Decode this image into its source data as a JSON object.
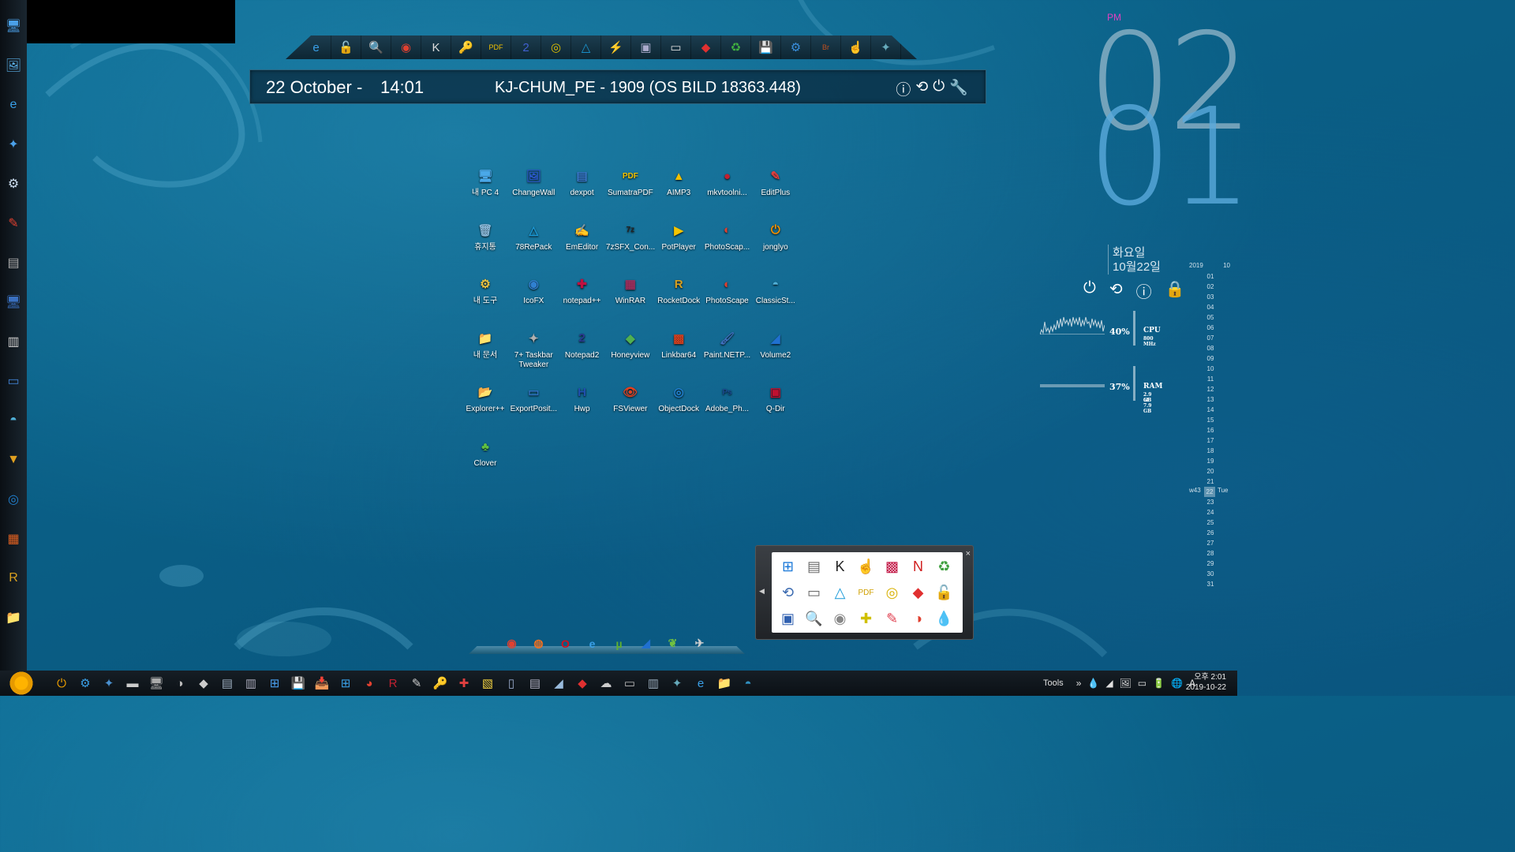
{
  "top_toolbar": {
    "icons": [
      "ie-icon",
      "unlock-icon",
      "search-icon",
      "screenshot-icon",
      "k-app-icon",
      "key-icon",
      "pdf-icon",
      "notepad2-icon",
      "cd-icon",
      "78repack-icon",
      "flash-icon",
      "display-icon",
      "note-icon",
      "git-icon",
      "green-app-icon",
      "floppy-icon",
      "gear-icon",
      "bridge-icon",
      "hand-icon",
      "tweak-icon"
    ]
  },
  "info_bar": {
    "date": "22 October -",
    "time": "14:01",
    "host": "KJ-CHUM_PE - 1909 (OS BILD 18363.448)",
    "controls": [
      "ⓘ",
      "⟲",
      "⏻",
      "🔧"
    ]
  },
  "desktop_icons": [
    {
      "label": "내 PC 4",
      "glyph": "🖥",
      "color": "#4aa8e8"
    },
    {
      "label": "ChangeWall",
      "glyph": "🖼",
      "color": "#2a58c8"
    },
    {
      "label": "dexpot",
      "glyph": "▤",
      "color": "#3a7ad0"
    },
    {
      "label": "SumatraPDF",
      "glyph": "PDF",
      "color": "#f4c400"
    },
    {
      "label": "AIMP3",
      "glyph": "▲",
      "color": "#f0c000"
    },
    {
      "label": "mkvtoolni...",
      "glyph": "●",
      "color": "#c02030"
    },
    {
      "label": "EditPlus",
      "glyph": "✎",
      "color": "#e04040"
    },
    {
      "label": "휴지통",
      "glyph": "🗑",
      "color": "#8ab8d8"
    },
    {
      "label": "78RePack",
      "glyph": "△",
      "color": "#1a9ad8"
    },
    {
      "label": "EmEditor",
      "glyph": "✍",
      "color": "#e8e8e8"
    },
    {
      "label": "7zSFX_Con...",
      "glyph": "7z",
      "color": "#222"
    },
    {
      "label": "PotPlayer",
      "glyph": "▶",
      "color": "#f4c400"
    },
    {
      "label": "PhotoScap...",
      "glyph": "◐",
      "color": "#e04030"
    },
    {
      "label": "jonglyo",
      "glyph": "⏻",
      "color": "#f09000"
    },
    {
      "label": "내 도구",
      "glyph": "⚙",
      "color": "#e8c040"
    },
    {
      "label": "IcoFX",
      "glyph": "◉",
      "color": "#3080d0"
    },
    {
      "label": "notepad++",
      "glyph": "✚",
      "color": "#c01040"
    },
    {
      "label": "WinRAR",
      "glyph": "▦",
      "color": "#a03060"
    },
    {
      "label": "RocketDock",
      "glyph": "R",
      "color": "#d8a020"
    },
    {
      "label": "PhotoScape",
      "glyph": "◐",
      "color": "#e04030"
    },
    {
      "label": "ClassicSt...",
      "glyph": "◓",
      "color": "#50b0d8"
    },
    {
      "label": "내 문서",
      "glyph": "📁",
      "color": "#f0d060"
    },
    {
      "label": "7+ Taskbar Tweaker",
      "glyph": "✦",
      "color": "#b0b0b0"
    },
    {
      "label": "Notepad2",
      "glyph": "2",
      "color": "#2a3a90"
    },
    {
      "label": "Honeyview",
      "glyph": "◆",
      "color": "#50b050"
    },
    {
      "label": "Linkbar64",
      "glyph": "▩",
      "color": "#d04020"
    },
    {
      "label": "Paint.NETP...",
      "glyph": "🖌",
      "color": "#4070c0"
    },
    {
      "label": "Volume2",
      "glyph": "◢",
      "color": "#2070d0"
    },
    {
      "label": "Explorer++",
      "glyph": "📂",
      "color": "#e8c050"
    },
    {
      "label": "ExportPosit...",
      "glyph": "▭",
      "color": "#3070c0"
    },
    {
      "label": "Hwp",
      "glyph": "H",
      "color": "#2050b0"
    },
    {
      "label": "FSViewer",
      "glyph": "👁",
      "color": "#e04020"
    },
    {
      "label": "ObjectDock",
      "glyph": "◎",
      "color": "#2080d0"
    },
    {
      "label": "Adobe_Ph...",
      "glyph": "Ps",
      "color": "#1a4a90"
    },
    {
      "label": "Q-Dir",
      "glyph": "▣",
      "color": "#c01030"
    },
    {
      "label": "Clover",
      "glyph": "♣",
      "color": "#60c040"
    }
  ],
  "big_clock": {
    "hour": "02",
    "minute": "01",
    "ampm": "PM"
  },
  "date_widget": {
    "weekday": "화요일",
    "date": "10월22일"
  },
  "power_buttons": [
    "⏻",
    "⟲",
    "ⓘ",
    "🔒"
  ],
  "calendar": {
    "year": "2019",
    "month": "10",
    "days": [
      "01",
      "02",
      "03",
      "04",
      "05",
      "06",
      "07",
      "08",
      "09",
      "10",
      "11",
      "12",
      "13",
      "14",
      "15",
      "16",
      "17",
      "18",
      "19",
      "20",
      "21",
      "22",
      "23",
      "24",
      "25",
      "26",
      "27",
      "28",
      "29",
      "30",
      "31"
    ],
    "today": "22",
    "week_label": "w43",
    "today_dow": "Tue"
  },
  "cpu_meter": {
    "percent": "40%",
    "name": "CPU",
    "sub": "800 MHz"
  },
  "ram_meter": {
    "percent": "37%",
    "name": "RAM",
    "sub1": "2.9 GB",
    "sub2": "of 7.9 GB"
  },
  "bottom_dock": {
    "icons": [
      {
        "name": "chrome-icon",
        "glyph": "◉",
        "color": "#e04030"
      },
      {
        "name": "firefox-icon",
        "glyph": "◍",
        "color": "#f07020"
      },
      {
        "name": "opera-icon",
        "glyph": "O",
        "color": "#d01020"
      },
      {
        "name": "ie-icon",
        "glyph": "e",
        "color": "#3aa0e8"
      },
      {
        "name": "utorrent-icon",
        "glyph": "µ",
        "color": "#60b030"
      },
      {
        "name": "volume2-icon",
        "glyph": "◢",
        "color": "#2070d0"
      },
      {
        "name": "leaf-icon",
        "glyph": "❦",
        "color": "#70c040"
      },
      {
        "name": "tweak-icon",
        "glyph": "✈",
        "color": "#d0d0d0"
      }
    ]
  },
  "quick_panel": {
    "close": "×",
    "icons": [
      "windows-icon",
      "scanner-icon",
      "k-app-icon",
      "hand-icon",
      "winrar-icon",
      "nt-icon",
      "green-app-icon",
      "backup-icon",
      "drive-icon",
      "78repack-icon",
      "pdf-icon",
      "cd-icon",
      "git-icon",
      "unlock-icon",
      "display-icon",
      "search-icon",
      "dvd-icon",
      "puzzle-icon",
      "editplus-icon",
      "pie-icon",
      "drop-icon"
    ],
    "glyphs": [
      "⊞",
      "▤",
      "K",
      "☝",
      "▩",
      "N",
      "♻",
      "⟲",
      "▭",
      "△",
      "PDF",
      "◎",
      "◆",
      "🔓",
      "▣",
      "🔍",
      "◉",
      "✚",
      "✎",
      "◑",
      "💧"
    ],
    "colors": [
      "#1a78d8",
      "#6a6a6a",
      "#222",
      "#888",
      "#c01040",
      "#d02020",
      "#40a040",
      "#3a6ab0",
      "#666",
      "#1a9ad8",
      "#d0a000",
      "#d8b000",
      "#e03030",
      "#888",
      "#3060b0",
      "#e07010",
      "#888",
      "#d0c000",
      "#e04050",
      "#e04030",
      "#3090e0"
    ]
  },
  "taskbar": {
    "tasks": [
      "⏻",
      "⚙",
      "✦",
      "▬",
      "🖥",
      "◑",
      "◆",
      "▤",
      "▥",
      "⊞",
      "💾",
      "📥",
      "⊞",
      "◕",
      "R",
      "✎",
      "🔑",
      "✚",
      "▧",
      "▯",
      "▤",
      "◢",
      "◆",
      "☁",
      "▭",
      "▥",
      "✦",
      "e",
      "📁",
      "◓"
    ],
    "colors": [
      "#f0a000",
      "#3aa0e8",
      "#4a90d0",
      "#ccc",
      "#aaa",
      "#bbb",
      "#ccc",
      "#9ab",
      "#aab",
      "#4aa0f0",
      "#3060c0",
      "#e0c040",
      "#3aa0e8",
      "#e04030",
      "#c02030",
      "#ccc",
      "#e0c000",
      "#e04040",
      "#f0d040",
      "#9ac",
      "#aab",
      "#9bd",
      "#e03030",
      "#ccc",
      "#bbb",
      "#9ab",
      "#6ab",
      "#3aa0e8",
      "#e8c040",
      "#3090c0"
    ],
    "tray_label": "Tools",
    "tray_icons": [
      "»",
      "💧",
      "◢",
      "🖼",
      "▭",
      "🔋",
      "🌐",
      "A"
    ],
    "clock_time": "오후 2:01",
    "clock_date": "2019-10-22"
  },
  "left_dock": {
    "glyphs": [
      "🖥",
      "🖼",
      "e",
      "✦",
      "⚙",
      "✎",
      "▤",
      "🖥",
      "▥",
      "▭",
      "◓",
      "▼",
      "◎",
      "▦",
      "R",
      "📁"
    ],
    "colors": [
      "#4aa0e8",
      "#5ab0e8",
      "#3aa0e8",
      "#4aa0e8",
      "#cde",
      "#e04030",
      "#aaa",
      "#3a70c0",
      "#ccc",
      "#4080d0",
      "#50b0d8",
      "#e0a020",
      "#2080d0",
      "#e06020",
      "#d8a020",
      "#e8c050"
    ]
  }
}
